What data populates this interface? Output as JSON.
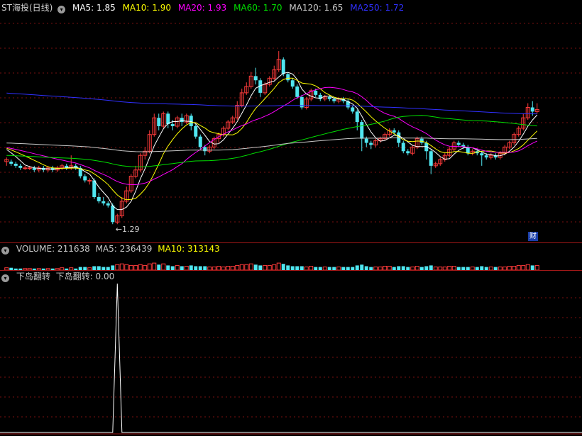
{
  "main": {
    "title": "ST海投(日线)",
    "ma": [
      {
        "label": "MA5: 1.85",
        "color": "#ffffff"
      },
      {
        "label": "MA10: 1.90",
        "color": "#ffff00"
      },
      {
        "label": "MA20: 1.93",
        "color": "#ff00ff"
      },
      {
        "label": "MA60: 1.70",
        "color": "#00e000"
      },
      {
        "label": "MA120: 1.65",
        "color": "#c8c8c8"
      },
      {
        "label": "MA250: 1.72",
        "color": "#2020ff"
      }
    ],
    "low_marker": "←1.29",
    "finance_badge": "财"
  },
  "volume": {
    "label": "VOLUME: 211638",
    "ma5": "MA5: 236439",
    "ma10": "MA10: 313143"
  },
  "indicator": {
    "name": "下岛翻转",
    "value": "下岛翻转: 0.00"
  },
  "colors": {
    "up": "#ff3b3b",
    "down": "#50e6f0",
    "grid": "#7a1010",
    "axis": "#a01818"
  },
  "chart_data": [
    {
      "type": "candlestick",
      "title": "ST海投(日线)",
      "lowest_label": "1.29",
      "ylim": [
        1.25,
        2.28
      ],
      "candles": [
        [
          1.59,
          1.6,
          1.61,
          1.57
        ],
        [
          1.59,
          1.58,
          1.6,
          1.57
        ],
        [
          1.58,
          1.57,
          1.59,
          1.56
        ],
        [
          1.57,
          1.56,
          1.58,
          1.55
        ],
        [
          1.56,
          1.56,
          1.57,
          1.55
        ],
        [
          1.56,
          1.56,
          1.57,
          1.55
        ],
        [
          1.56,
          1.55,
          1.57,
          1.54
        ],
        [
          1.55,
          1.56,
          1.57,
          1.54
        ],
        [
          1.56,
          1.55,
          1.57,
          1.54
        ],
        [
          1.55,
          1.56,
          1.57,
          1.54
        ],
        [
          1.56,
          1.55,
          1.57,
          1.54
        ],
        [
          1.55,
          1.56,
          1.57,
          1.54
        ],
        [
          1.56,
          1.57,
          1.58,
          1.55
        ],
        [
          1.57,
          1.56,
          1.58,
          1.55
        ],
        [
          1.56,
          1.57,
          1.62,
          1.55
        ],
        [
          1.57,
          1.56,
          1.58,
          1.55
        ],
        [
          1.56,
          1.52,
          1.57,
          1.51
        ],
        [
          1.52,
          1.5,
          1.53,
          1.49
        ],
        [
          1.5,
          1.5,
          1.51,
          1.48
        ],
        [
          1.5,
          1.42,
          1.51,
          1.41
        ],
        [
          1.42,
          1.4,
          1.44,
          1.39
        ],
        [
          1.4,
          1.39,
          1.42,
          1.38
        ],
        [
          1.39,
          1.38,
          1.4,
          1.37
        ],
        [
          1.38,
          1.3,
          1.39,
          1.29
        ],
        [
          1.3,
          1.33,
          1.34,
          1.29
        ],
        [
          1.33,
          1.4,
          1.42,
          1.32
        ],
        [
          1.4,
          1.45,
          1.47,
          1.39
        ],
        [
          1.45,
          1.52,
          1.53,
          1.44
        ],
        [
          1.52,
          1.55,
          1.57,
          1.51
        ],
        [
          1.55,
          1.62,
          1.63,
          1.54
        ],
        [
          1.62,
          1.64,
          1.66,
          1.6
        ],
        [
          1.64,
          1.72,
          1.74,
          1.63
        ],
        [
          1.72,
          1.8,
          1.82,
          1.71
        ],
        [
          1.8,
          1.76,
          1.82,
          1.74
        ],
        [
          1.76,
          1.82,
          1.83,
          1.75
        ],
        [
          1.82,
          1.77,
          1.83,
          1.75
        ],
        [
          1.77,
          1.76,
          1.79,
          1.74
        ],
        [
          1.76,
          1.8,
          1.81,
          1.75
        ],
        [
          1.8,
          1.78,
          1.82,
          1.76
        ],
        [
          1.78,
          1.81,
          1.82,
          1.77
        ],
        [
          1.81,
          1.76,
          1.82,
          1.74
        ],
        [
          1.76,
          1.71,
          1.77,
          1.7
        ],
        [
          1.71,
          1.66,
          1.72,
          1.65
        ],
        [
          1.66,
          1.64,
          1.67,
          1.62
        ],
        [
          1.64,
          1.66,
          1.67,
          1.63
        ],
        [
          1.66,
          1.7,
          1.71,
          1.65
        ],
        [
          1.7,
          1.72,
          1.73,
          1.68
        ],
        [
          1.72,
          1.75,
          1.76,
          1.71
        ],
        [
          1.75,
          1.78,
          1.79,
          1.74
        ],
        [
          1.78,
          1.8,
          1.81,
          1.77
        ],
        [
          1.8,
          1.86,
          1.88,
          1.79
        ],
        [
          1.86,
          1.92,
          1.94,
          1.85
        ],
        [
          1.92,
          1.95,
          1.97,
          1.91
        ],
        [
          1.95,
          2.0,
          2.02,
          1.94
        ],
        [
          2.0,
          1.98,
          2.04,
          1.96
        ],
        [
          1.98,
          1.92,
          1.99,
          1.9
        ],
        [
          1.92,
          1.96,
          1.97,
          1.91
        ],
        [
          1.96,
          1.99,
          2.0,
          1.95
        ],
        [
          1.99,
          2.03,
          2.05,
          1.98
        ],
        [
          2.03,
          2.08,
          2.12,
          2.02
        ],
        [
          2.08,
          2.01,
          2.09,
          2.0
        ],
        [
          2.01,
          1.98,
          2.02,
          1.97
        ],
        [
          1.98,
          1.95,
          1.99,
          1.94
        ],
        [
          1.95,
          1.9,
          1.96,
          1.89
        ],
        [
          1.9,
          1.85,
          1.91,
          1.84
        ],
        [
          1.85,
          1.89,
          1.9,
          1.84
        ],
        [
          1.89,
          1.93,
          1.94,
          1.88
        ],
        [
          1.93,
          1.91,
          1.94,
          1.9
        ],
        [
          1.91,
          1.89,
          1.92,
          1.88
        ],
        [
          1.89,
          1.9,
          1.91,
          1.88
        ],
        [
          1.9,
          1.89,
          1.91,
          1.88
        ],
        [
          1.89,
          1.88,
          1.9,
          1.87
        ],
        [
          1.88,
          1.89,
          1.9,
          1.87
        ],
        [
          1.89,
          1.88,
          1.9,
          1.87
        ],
        [
          1.88,
          1.85,
          1.89,
          1.84
        ],
        [
          1.85,
          1.83,
          1.86,
          1.82
        ],
        [
          1.83,
          1.78,
          1.84,
          1.74
        ],
        [
          1.78,
          1.7,
          1.79,
          1.64
        ],
        [
          1.7,
          1.68,
          1.71,
          1.66
        ],
        [
          1.68,
          1.67,
          1.69,
          1.65
        ],
        [
          1.67,
          1.69,
          1.7,
          1.66
        ],
        [
          1.69,
          1.7,
          1.71,
          1.68
        ],
        [
          1.7,
          1.72,
          1.73,
          1.69
        ],
        [
          1.72,
          1.74,
          1.75,
          1.71
        ],
        [
          1.74,
          1.73,
          1.75,
          1.72
        ],
        [
          1.73,
          1.68,
          1.74,
          1.66
        ],
        [
          1.68,
          1.64,
          1.69,
          1.63
        ],
        [
          1.64,
          1.63,
          1.65,
          1.62
        ],
        [
          1.63,
          1.66,
          1.67,
          1.62
        ],
        [
          1.66,
          1.7,
          1.71,
          1.65
        ],
        [
          1.7,
          1.68,
          1.71,
          1.67
        ],
        [
          1.68,
          1.64,
          1.69,
          1.6
        ],
        [
          1.64,
          1.57,
          1.65,
          1.53
        ],
        [
          1.57,
          1.58,
          1.59,
          1.56
        ],
        [
          1.58,
          1.6,
          1.61,
          1.57
        ],
        [
          1.6,
          1.62,
          1.63,
          1.59
        ],
        [
          1.62,
          1.65,
          1.66,
          1.61
        ],
        [
          1.65,
          1.68,
          1.69,
          1.64
        ],
        [
          1.68,
          1.67,
          1.69,
          1.66
        ],
        [
          1.67,
          1.66,
          1.68,
          1.65
        ],
        [
          1.66,
          1.63,
          1.67,
          1.62
        ],
        [
          1.63,
          1.64,
          1.65,
          1.62
        ],
        [
          1.64,
          1.63,
          1.65,
          1.62
        ],
        [
          1.63,
          1.62,
          1.64,
          1.57
        ],
        [
          1.62,
          1.61,
          1.63,
          1.6
        ],
        [
          1.61,
          1.62,
          1.63,
          1.6
        ],
        [
          1.62,
          1.61,
          1.63,
          1.6
        ],
        [
          1.61,
          1.63,
          1.64,
          1.6
        ],
        [
          1.63,
          1.66,
          1.67,
          1.62
        ],
        [
          1.66,
          1.68,
          1.69,
          1.65
        ],
        [
          1.68,
          1.72,
          1.73,
          1.67
        ],
        [
          1.72,
          1.75,
          1.76,
          1.71
        ],
        [
          1.75,
          1.8,
          1.82,
          1.74
        ],
        [
          1.8,
          1.85,
          1.87,
          1.79
        ],
        [
          1.85,
          1.83,
          1.88,
          1.81
        ],
        [
          1.83,
          1.84,
          1.87,
          1.82
        ]
      ],
      "ma_windows": [
        5,
        10,
        20,
        60,
        120,
        250
      ]
    },
    {
      "type": "bar",
      "title": "VOLUME",
      "values": [
        3,
        3,
        2,
        2,
        2,
        2,
        2,
        2,
        2,
        2,
        2,
        2,
        3,
        2,
        3,
        2,
        4,
        4,
        3,
        5,
        5,
        4,
        4,
        6,
        7,
        8,
        7,
        6,
        6,
        7,
        6,
        8,
        9,
        7,
        8,
        6,
        5,
        6,
        5,
        5,
        6,
        5,
        5,
        5,
        4,
        4,
        5,
        4,
        5,
        5,
        6,
        7,
        7,
        8,
        7,
        6,
        6,
        6,
        7,
        9,
        8,
        6,
        5,
        5,
        5,
        4,
        5,
        4,
        4,
        4,
        4,
        4,
        4,
        4,
        4,
        4,
        6,
        7,
        5,
        4,
        4,
        4,
        5,
        5,
        4,
        5,
        5,
        4,
        4,
        5,
        4,
        5,
        6,
        4,
        4,
        4,
        5,
        5,
        4,
        4,
        4,
        4,
        4,
        5,
        4,
        4,
        4,
        4,
        4,
        5,
        5,
        6,
        6,
        7,
        6,
        6
      ]
    },
    {
      "type": "line",
      "title": "下岛翻转",
      "value_label": "0.00",
      "ylim": [
        0,
        1
      ],
      "values_nonzero": [
        {
          "index": 24,
          "value": 1
        }
      ]
    }
  ]
}
